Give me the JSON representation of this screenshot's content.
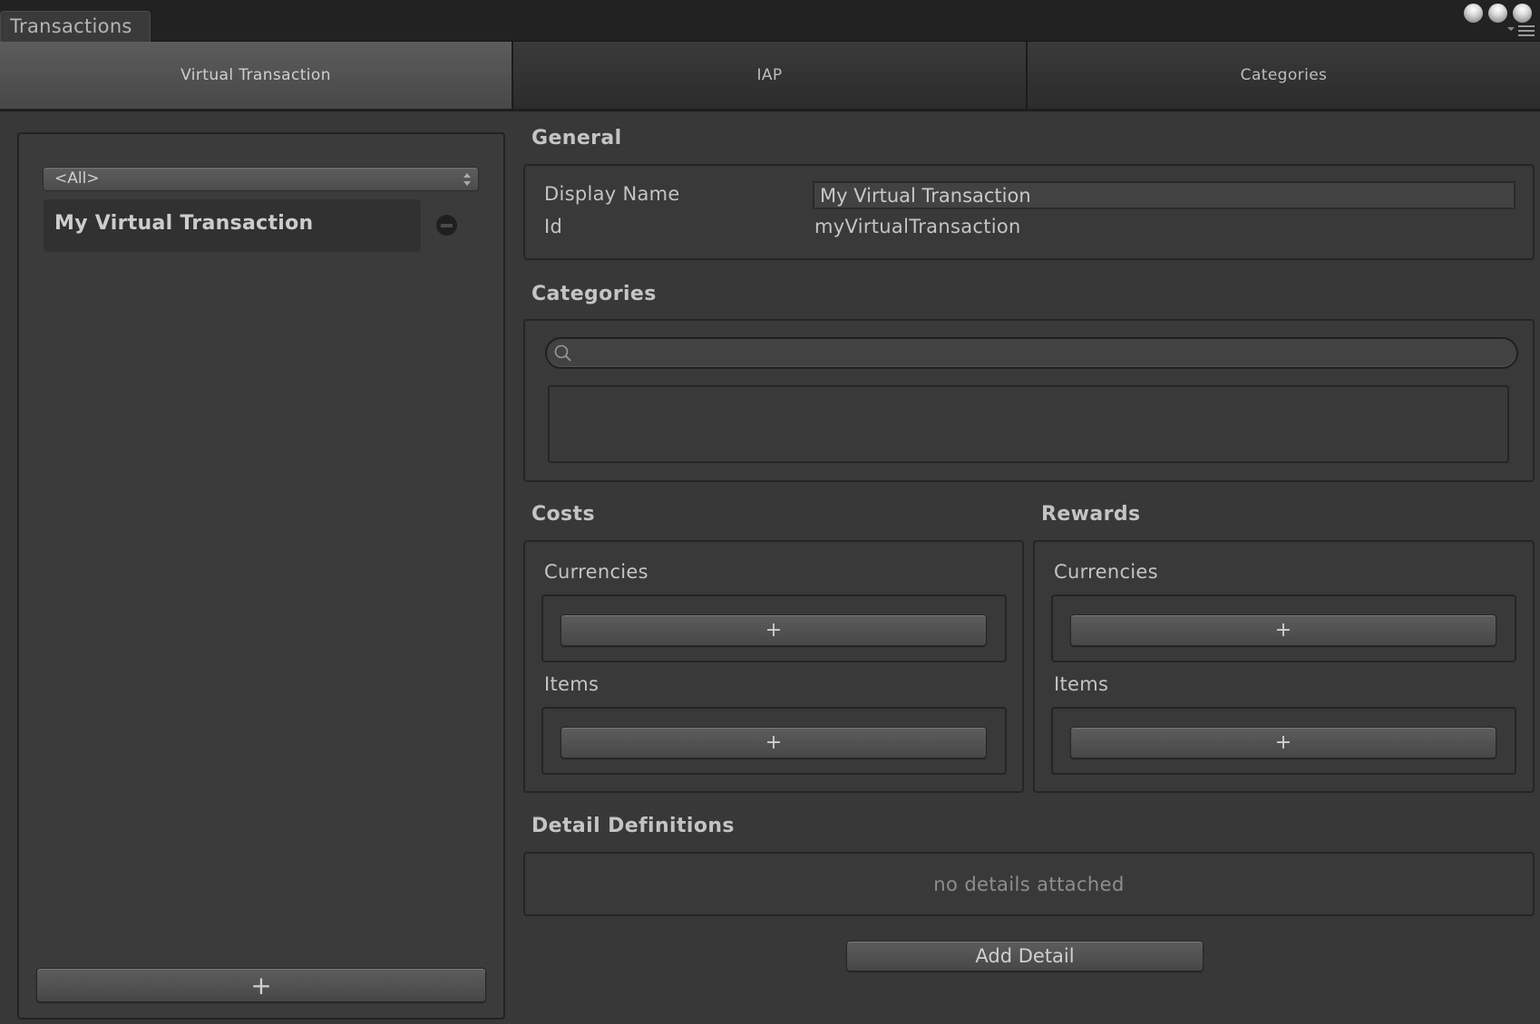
{
  "window": {
    "tab_title": "Transactions",
    "controls": [
      "window-dot-icon",
      "window-dot-icon",
      "window-dot-icon"
    ],
    "menu_icon": "context-menu-icon"
  },
  "tabs": [
    {
      "label": "Virtual Transaction",
      "active": true
    },
    {
      "label": "IAP",
      "active": false
    },
    {
      "label": "Categories",
      "active": false
    }
  ],
  "sidebar": {
    "filter": {
      "selected": "<All>"
    },
    "items": [
      {
        "label": "My Virtual Transaction",
        "selected": true
      }
    ],
    "remove_icon": "remove-circle-icon",
    "add_label": "+"
  },
  "general": {
    "title": "General",
    "display_name_label": "Display Name",
    "display_name_value": "My Virtual Transaction",
    "id_label": "Id",
    "id_value": "myVirtualTransaction"
  },
  "categories": {
    "title": "Categories",
    "search_value": "",
    "search_icon": "search-icon"
  },
  "costs": {
    "title": "Costs",
    "currencies_label": "Currencies",
    "currencies_add": "+",
    "items_label": "Items",
    "items_add": "+"
  },
  "rewards": {
    "title": "Rewards",
    "currencies_label": "Currencies",
    "currencies_add": "+",
    "items_label": "Items",
    "items_add": "+"
  },
  "details": {
    "title": "Detail Definitions",
    "empty_text": "no details attached",
    "add_label": "Add Detail"
  },
  "colors": {
    "background": "#383838",
    "titlebar": "#222222",
    "active_tab": "#545454",
    "inactive_tab": "#333333",
    "text": "#c4c4c4",
    "muted_text": "#8e8e8e"
  }
}
